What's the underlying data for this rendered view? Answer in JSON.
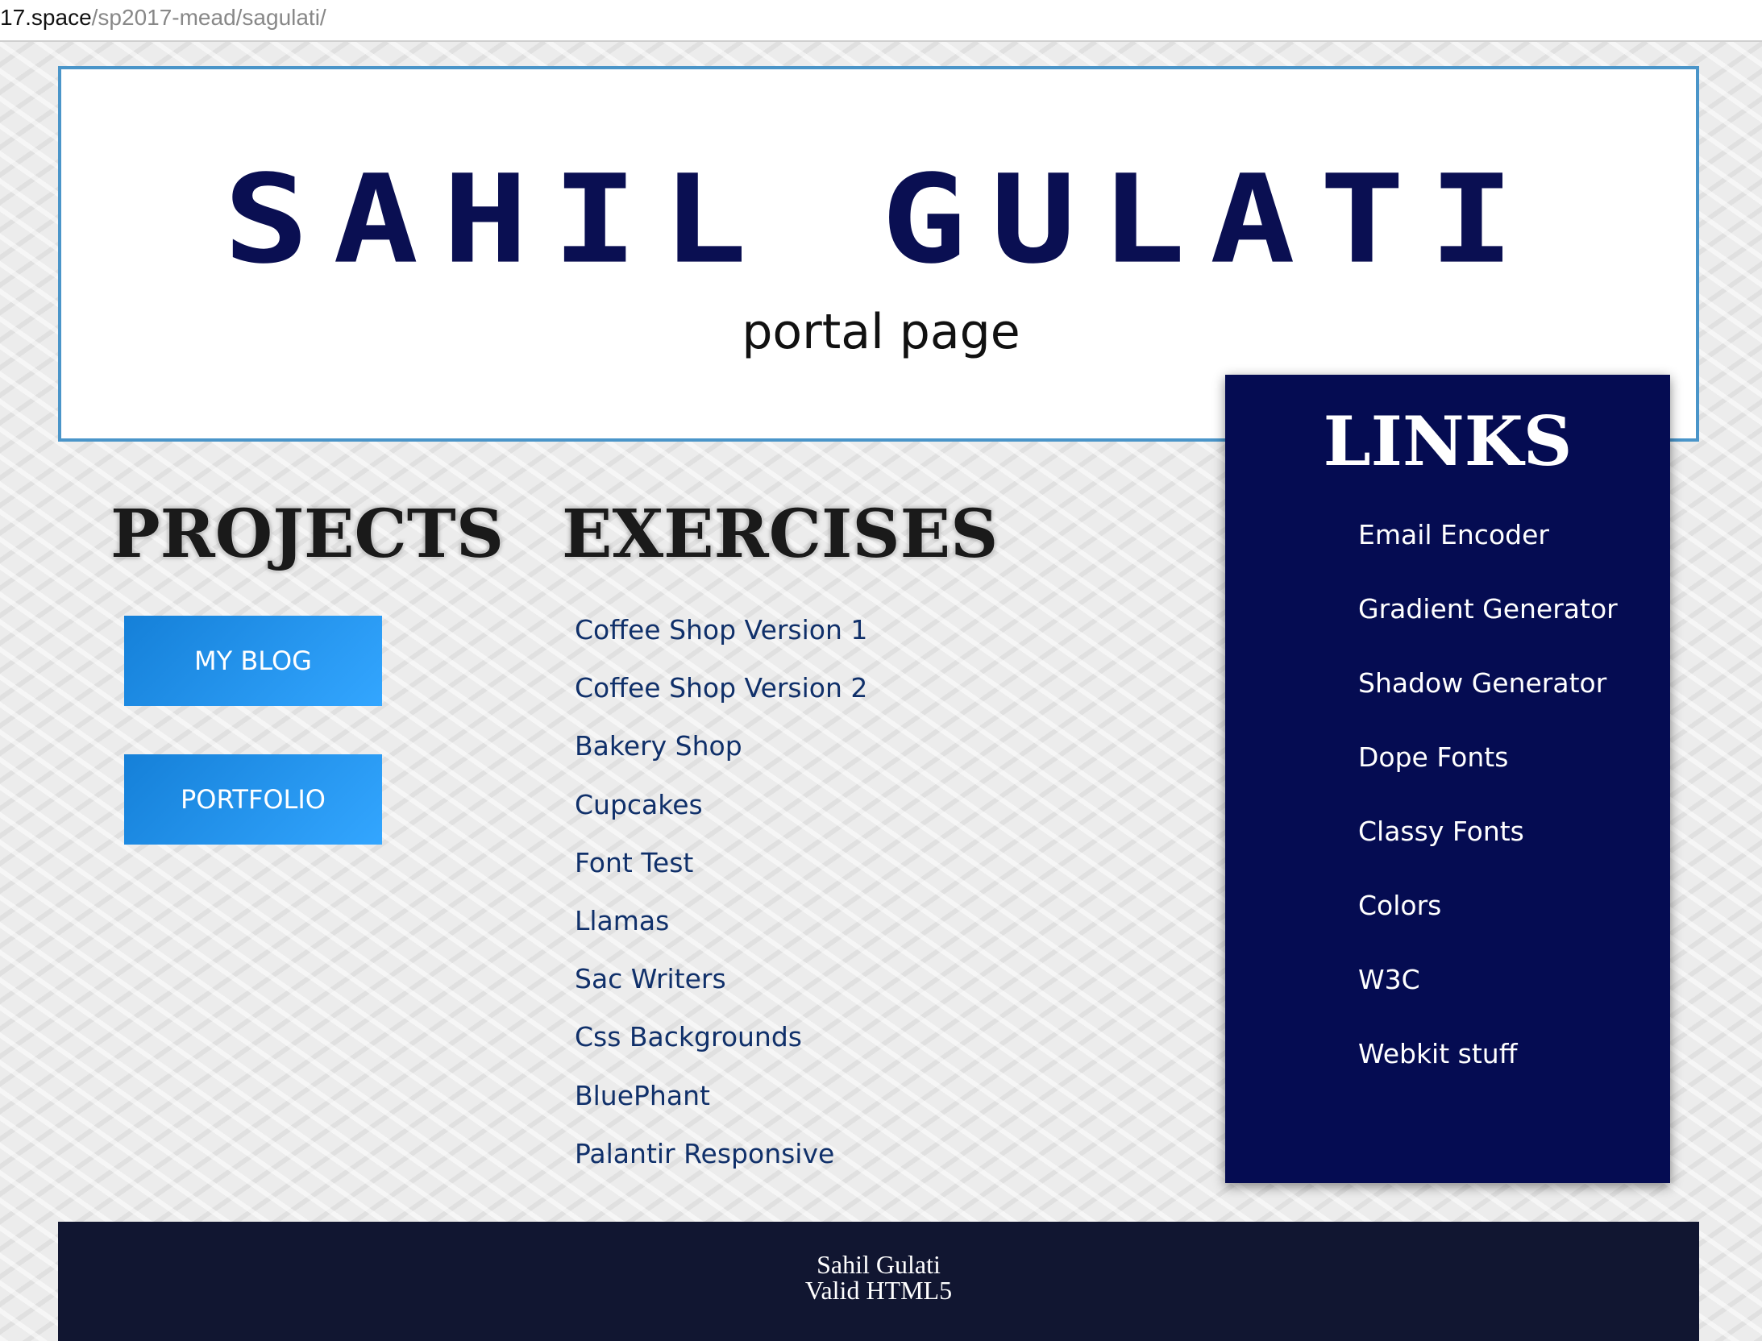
{
  "browser": {
    "url_host": "17.space",
    "url_path": "/sp2017-mead/sagulati/"
  },
  "header": {
    "title": "SAHIL GULATI",
    "subtitle": "portal page"
  },
  "projects": {
    "heading": "PROJECTS",
    "buttons": [
      "MY BLOG",
      "PORTFOLIO"
    ]
  },
  "exercises": {
    "heading": "EXERCISES",
    "items": [
      "Coffee Shop Version 1",
      "Coffee Shop Version 2",
      "Bakery Shop",
      "Cupcakes",
      "Font Test",
      "Llamas",
      "Sac Writers",
      "Css Backgrounds",
      "BluePhant",
      "Palantir Responsive"
    ]
  },
  "links": {
    "heading": "LINKS",
    "items": [
      "Email Encoder",
      "Gradient Generator",
      "Shadow Generator",
      "Dope Fonts",
      "Classy Fonts",
      "Colors",
      "W3C",
      "Webkit stuff"
    ]
  },
  "footer": {
    "name": "Sahil Gulati",
    "validation": "Valid HTML5"
  },
  "colors": {
    "title_navy": "#0a0f52",
    "header_border": "#4a95c9",
    "links_panel_bg": "#050c52",
    "button_blue": "#1a8ce8",
    "exercise_link": "#10306a",
    "footer_bg": "#111631"
  }
}
